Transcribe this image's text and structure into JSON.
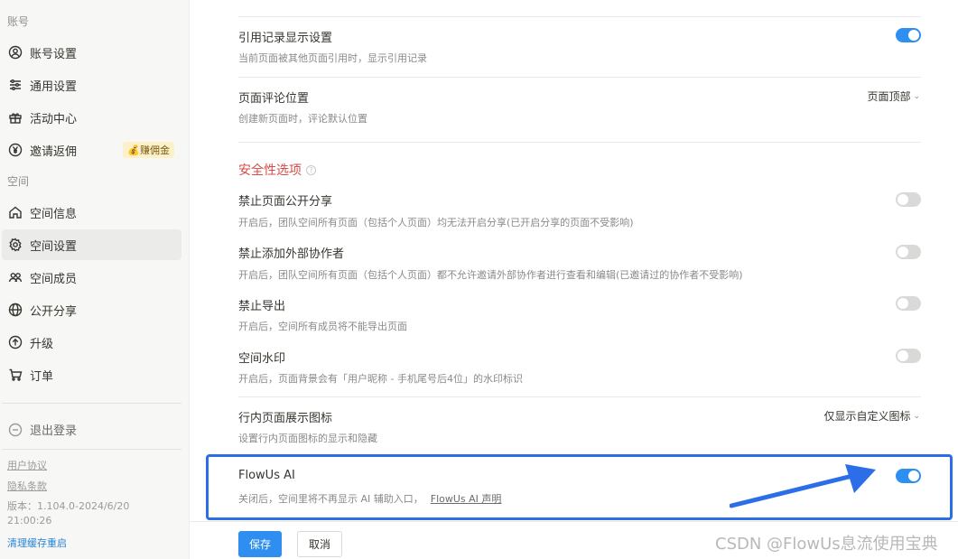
{
  "sidebar": {
    "account_section": "账号",
    "space_section": "空间",
    "items": [
      {
        "label": "账号设置",
        "icon": "user-circle-icon"
      },
      {
        "label": "通用设置",
        "icon": "sliders-icon"
      },
      {
        "label": "活动中心",
        "icon": "gift-icon"
      },
      {
        "label": "邀请返佣",
        "icon": "yen-icon",
        "badge": "💰赚佣金"
      },
      {
        "label": "空间信息",
        "icon": "home-icon"
      },
      {
        "label": "空间设置",
        "icon": "gear-icon",
        "active": true
      },
      {
        "label": "空间成员",
        "icon": "members-icon"
      },
      {
        "label": "公开分享",
        "icon": "globe-icon"
      },
      {
        "label": "升级",
        "icon": "upgrade-icon"
      },
      {
        "label": "订单",
        "icon": "cart-icon"
      }
    ],
    "logout_label": "退出登录",
    "user_agreement": "用户协议",
    "privacy_policy": "隐私条款",
    "version": "版本：1.104.0-2024/6/20 21:00:26",
    "clear_cache": "清理缓存重启"
  },
  "settings": {
    "citation": {
      "title": "引用记录显示设置",
      "desc": "当前页面被其他页面引用时，显示引用记录",
      "enabled": true
    },
    "comment_position": {
      "title": "页面评论位置",
      "desc": "创建新页面时，评论默认位置",
      "value": "页面顶部"
    },
    "security_heading": "安全性选项",
    "disable_share": {
      "title": "禁止页面公开分享",
      "desc": "开启后，团队空间所有页面（包括个人页面）均无法开启分享(已开启分享的页面不受影响)",
      "enabled": false
    },
    "disable_collaborator": {
      "title": "禁止添加外部协作者",
      "desc": "开启后，团队空间所有页面（包括个人页面）都不允许邀请外部协作者进行查看和编辑(已邀请过的协作者不受影响)",
      "enabled": false
    },
    "disable_export": {
      "title": "禁止导出",
      "desc": "开启后，空间所有成员将不能导出页面",
      "enabled": false
    },
    "watermark": {
      "title": "空间水印",
      "desc": "开启后，页面背景会有「用户昵称 - 手机尾号后4位」的水印标识",
      "enabled": false
    },
    "inline_icon": {
      "title": "行内页面展示图标",
      "desc": "设置行内页面图标的显示和隐藏",
      "value": "仅显示自定义图标"
    },
    "flowus_ai": {
      "title": "FlowUs AI",
      "desc": "关闭后，空间里将不再显示 AI 辅助入口，",
      "link": "FlowUs AI 声明",
      "enabled": true
    }
  },
  "actions": {
    "save": "保存",
    "cancel": "取消"
  },
  "watermark_text": "CSDN @FlowUs息流使用宝典",
  "colors": {
    "accent": "#2f8ff0",
    "highlight_box": "#2b6ee8",
    "danger": "#d44c47"
  }
}
